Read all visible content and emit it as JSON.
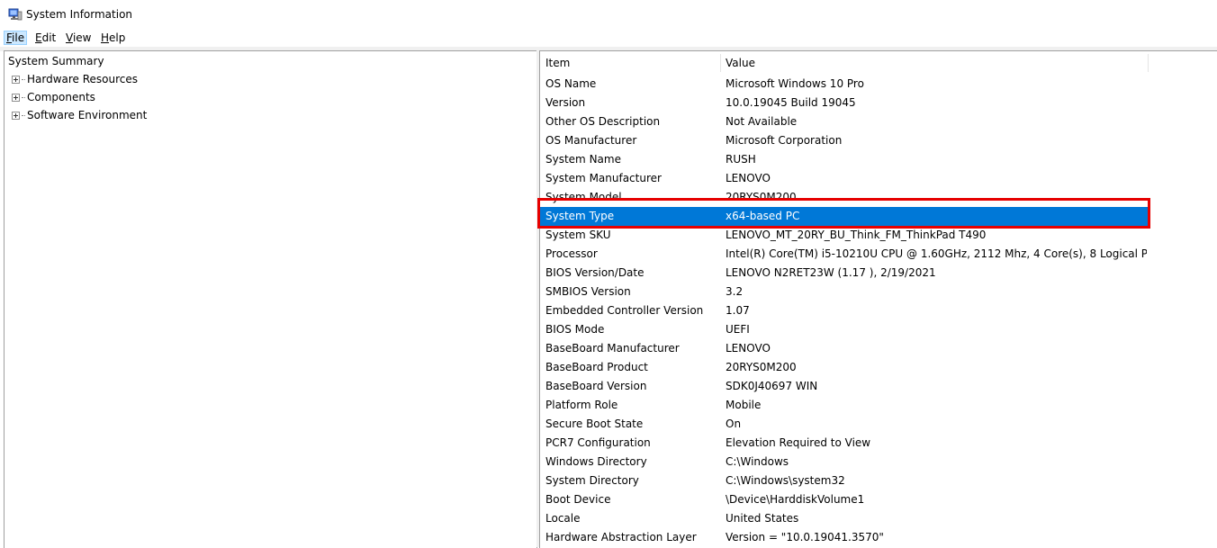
{
  "window": {
    "title": "System Information"
  },
  "menu": [
    {
      "label": "File",
      "accel": "F",
      "rest": "ile",
      "active": true
    },
    {
      "label": "Edit",
      "accel": "E",
      "rest": "dit",
      "active": false
    },
    {
      "label": "View",
      "accel": "V",
      "rest": "iew",
      "active": false
    },
    {
      "label": "Help",
      "accel": "H",
      "rest": "elp",
      "active": false
    }
  ],
  "tree": {
    "root": "System Summary",
    "children": [
      "Hardware Resources",
      "Components",
      "Software Environment"
    ]
  },
  "table": {
    "columns": [
      "Item",
      "Value"
    ],
    "selected_index": 8,
    "rows": [
      {
        "item": "OS Name",
        "value": "Microsoft Windows 10 Pro"
      },
      {
        "item": "Version",
        "value": "10.0.19045 Build 19045"
      },
      {
        "item": "Other OS Description",
        "value": "Not Available"
      },
      {
        "item": "OS Manufacturer",
        "value": "Microsoft Corporation"
      },
      {
        "item": "System Name",
        "value": "RUSH"
      },
      {
        "item": "System Manufacturer",
        "value": "LENOVO"
      },
      {
        "item": "System Model",
        "value": "20RYS0M200"
      },
      {
        "item": "System Type",
        "value": "x64-based PC"
      },
      {
        "item": "System SKU",
        "value": "LENOVO_MT_20RY_BU_Think_FM_ThinkPad T490"
      },
      {
        "item": "Processor",
        "value": "Intel(R) Core(TM) i5-10210U CPU @ 1.60GHz, 2112 Mhz, 4 Core(s), 8 Logical P..."
      },
      {
        "item": "BIOS Version/Date",
        "value": "LENOVO N2RET23W (1.17 ), 2/19/2021"
      },
      {
        "item": "SMBIOS Version",
        "value": "3.2"
      },
      {
        "item": "Embedded Controller Version",
        "value": "1.07"
      },
      {
        "item": "BIOS Mode",
        "value": "UEFI"
      },
      {
        "item": "BaseBoard Manufacturer",
        "value": "LENOVO"
      },
      {
        "item": "BaseBoard Product",
        "value": "20RYS0M200"
      },
      {
        "item": "BaseBoard Version",
        "value": "SDK0J40697 WIN"
      },
      {
        "item": "Platform Role",
        "value": "Mobile"
      },
      {
        "item": "Secure Boot State",
        "value": "On"
      },
      {
        "item": "PCR7 Configuration",
        "value": "Elevation Required to View"
      },
      {
        "item": "Windows Directory",
        "value": "C:\\Windows"
      },
      {
        "item": "System Directory",
        "value": "C:\\Windows\\system32"
      },
      {
        "item": "Boot Device",
        "value": "\\Device\\HarddiskVolume1"
      },
      {
        "item": "Locale",
        "value": "United States"
      },
      {
        "item": "Hardware Abstraction Layer",
        "value": "Version = \"10.0.19041.3570\""
      }
    ]
  },
  "colors": {
    "selection": "#0078d7",
    "annotation_box": "#e60000"
  }
}
